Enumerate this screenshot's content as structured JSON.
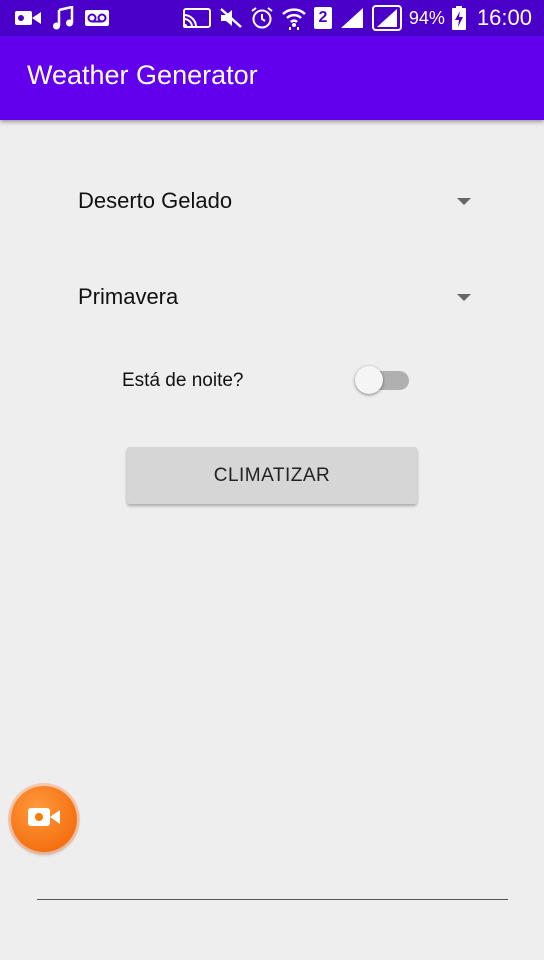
{
  "status_bar": {
    "battery_percent": "94%",
    "time": "16:00",
    "sim_badge": "2",
    "icons": [
      "video-camera-icon",
      "music-note-icon",
      "voicemail-icon",
      "cast-icon",
      "mute-icon",
      "alarm-icon",
      "wifi-icon",
      "sim-2-icon",
      "signal-icon",
      "signal-icon",
      "battery-charging-icon"
    ]
  },
  "app_bar": {
    "title": "Weather Generator"
  },
  "form": {
    "biome_spinner": {
      "selected": "Deserto Gelado"
    },
    "season_spinner": {
      "selected": "Primavera"
    },
    "night_switch": {
      "label": "Está de noite?",
      "checked": false
    },
    "submit_button": {
      "label": "CLIMATIZAR"
    }
  },
  "overlay": {
    "recorder_icon": "video-camera-icon"
  },
  "colors": {
    "status_bar": "#4a00c8",
    "app_bar": "#6200ee",
    "background": "#eeeeee",
    "button": "#d6d6d6",
    "fab": "#f57c00"
  }
}
